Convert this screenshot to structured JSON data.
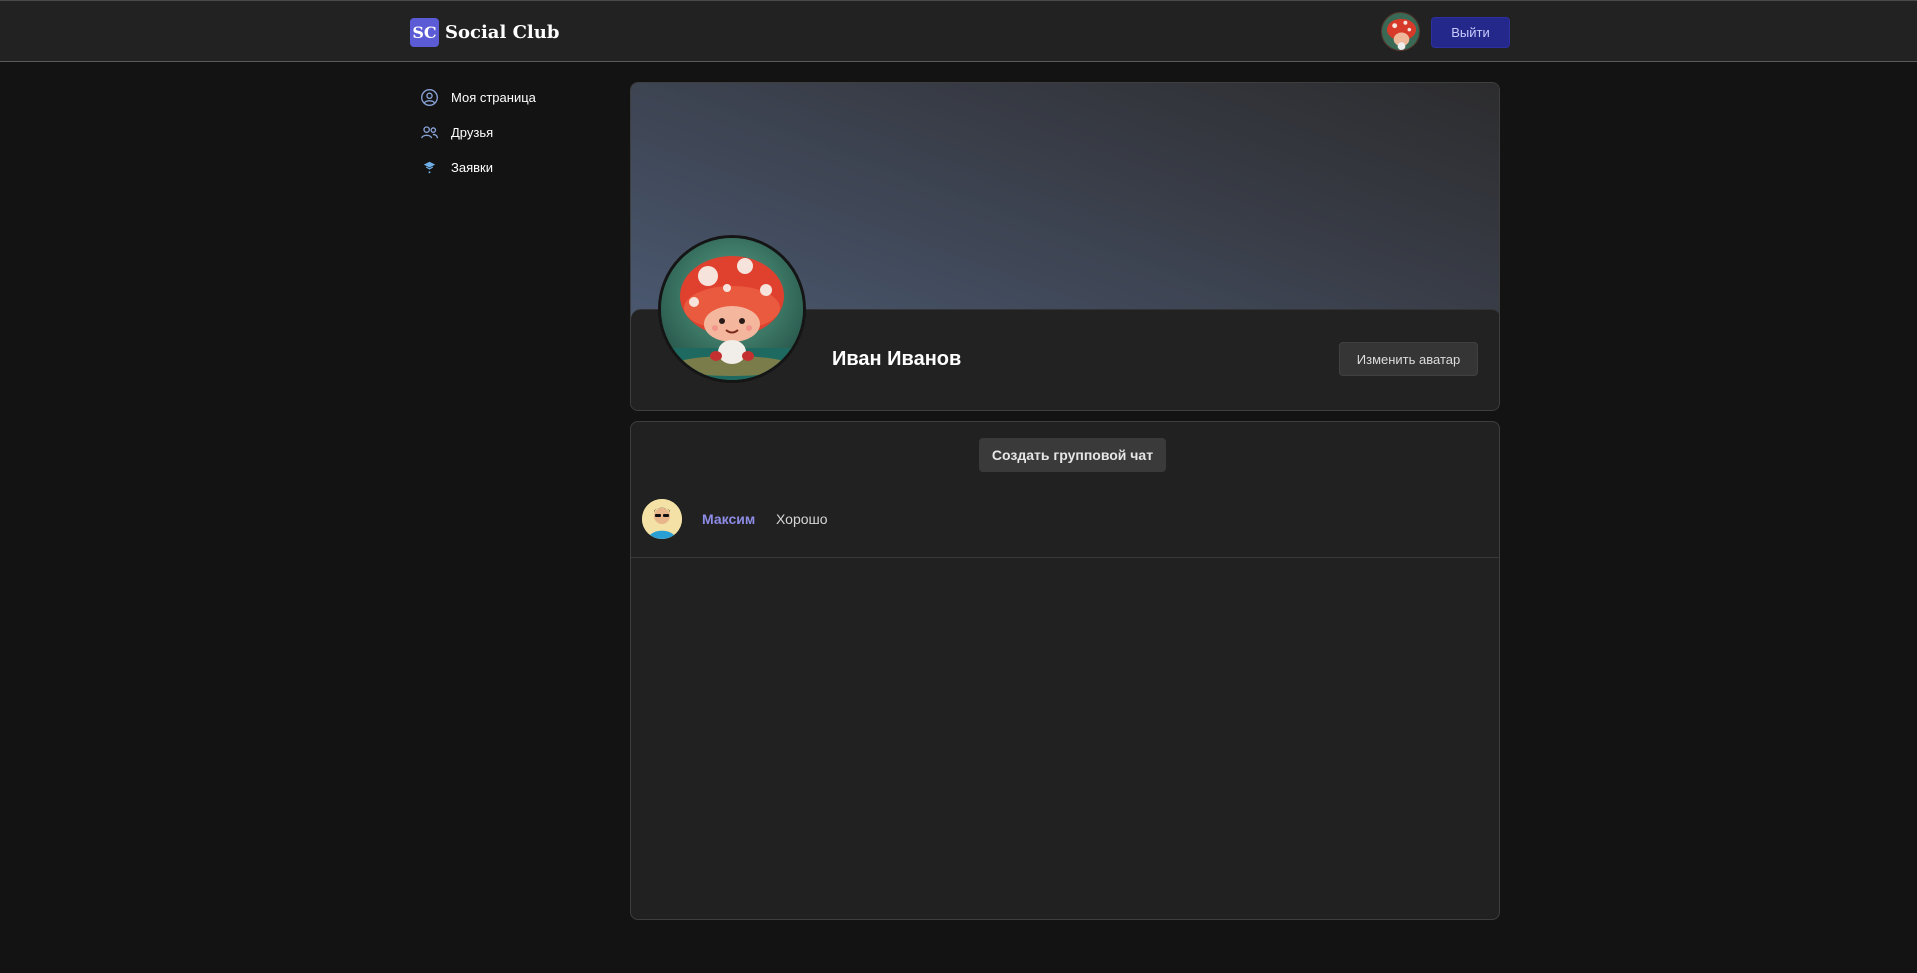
{
  "header": {
    "logo_badge": "SC",
    "logo_text": "Social Club",
    "logout_label": "Выйти"
  },
  "sidebar": {
    "items": [
      {
        "label": "Моя страница",
        "icon": "user-circle-icon"
      },
      {
        "label": "Друзья",
        "icon": "friends-icon"
      },
      {
        "label": "Заявки",
        "icon": "requests-icon"
      }
    ]
  },
  "profile": {
    "name": "Иван Иванов",
    "change_avatar_label": "Изменить аватар"
  },
  "chats": {
    "create_group_label": "Создать групповой чат",
    "items": [
      {
        "name": "Максим",
        "last_message": "Хорошо"
      }
    ]
  },
  "colors": {
    "accent": "#5b5bd6",
    "logout_bg": "#24288a",
    "chat_name": "#8d8ce6",
    "background": "#131313"
  }
}
